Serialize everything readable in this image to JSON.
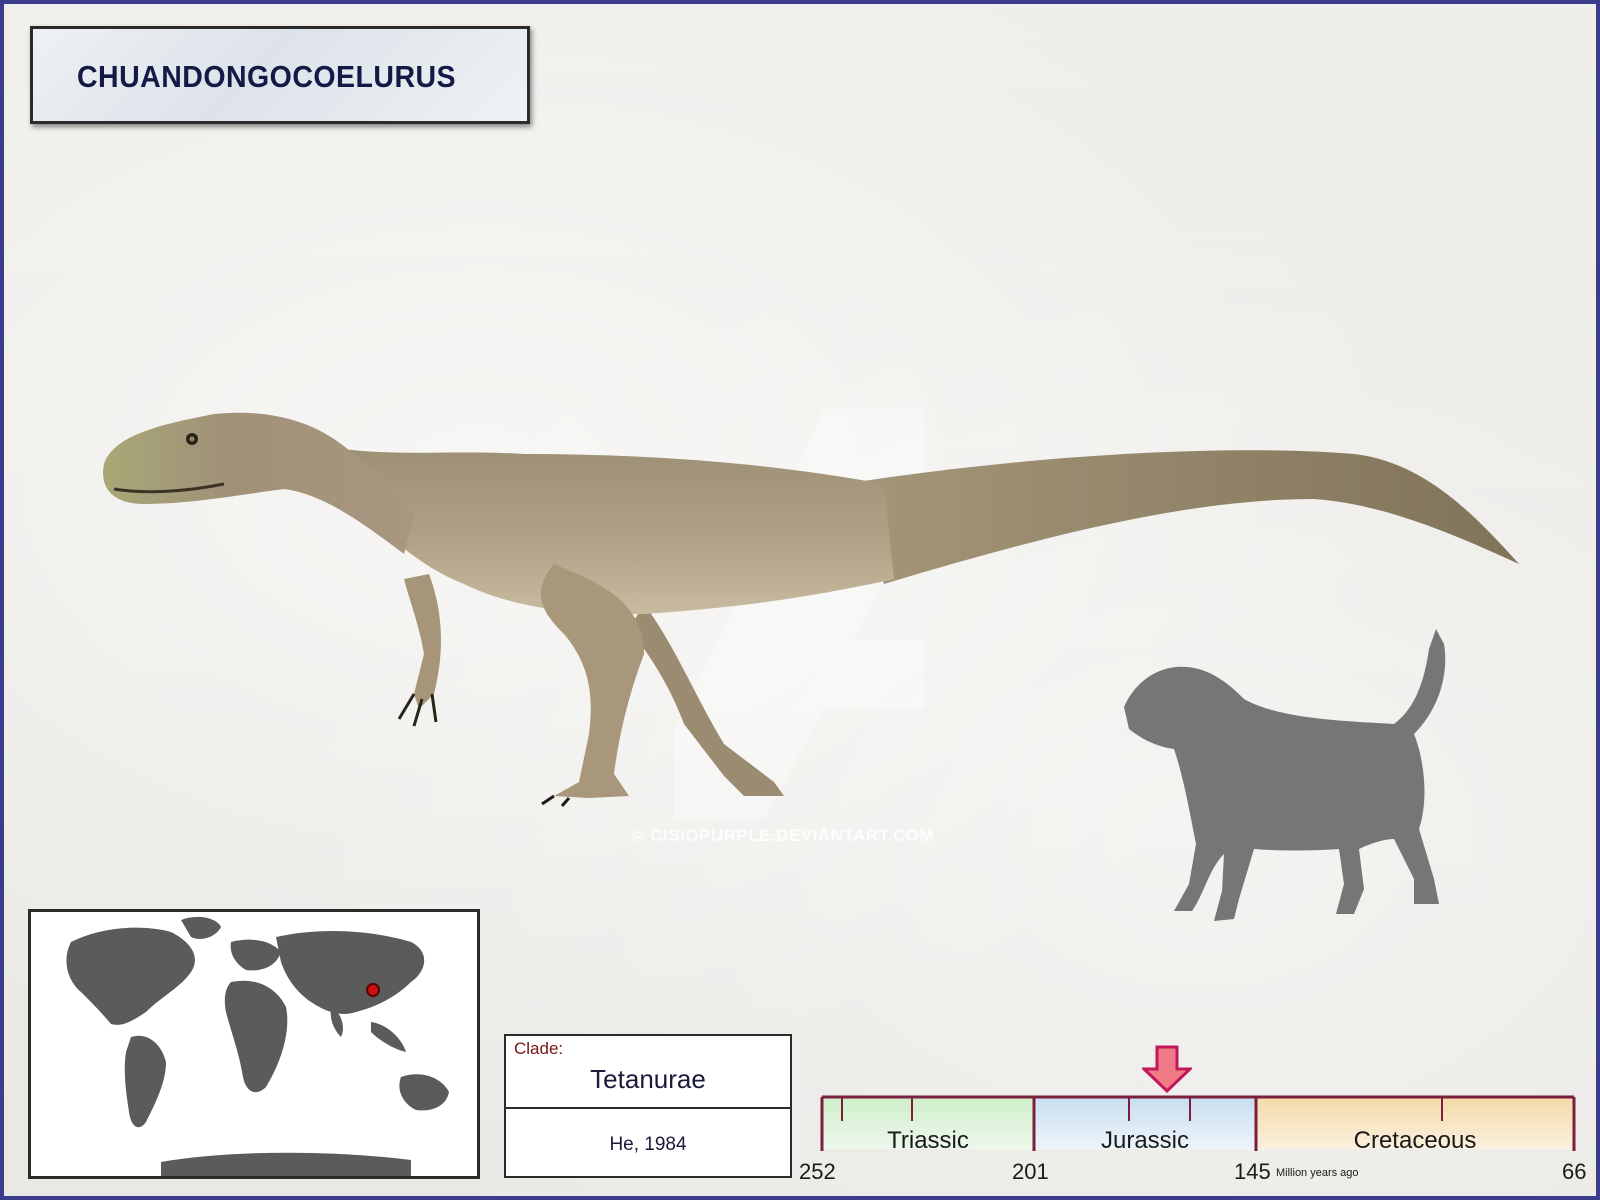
{
  "title": "CHUANDONGOCOELURUS",
  "watermark": "© CISIOPURPLE.DEVIANTART.COM",
  "clade": {
    "label": "Clade:",
    "name": "Tetanurae",
    "author": "He, 1984"
  },
  "timeline": {
    "periods": [
      {
        "name": "Triassic",
        "color": "#cdeec8"
      },
      {
        "name": "Jurassic",
        "color": "#c9def0"
      },
      {
        "name": "Cretaceous",
        "color": "#f3d9a8"
      }
    ],
    "ticks": [
      "252",
      "201",
      "145",
      "66"
    ],
    "unit": "Million years ago",
    "marker_color": "#f07a86"
  },
  "map": {
    "location_marker_color": "#cc1111",
    "land_color": "#5b5b5b"
  },
  "icons": {
    "map": "world-map-icon",
    "marker": "location-pin-icon",
    "arrow": "down-arrow-icon",
    "dinosaur": "theropod-illustration",
    "dog": "dog-silhouette-icon"
  }
}
